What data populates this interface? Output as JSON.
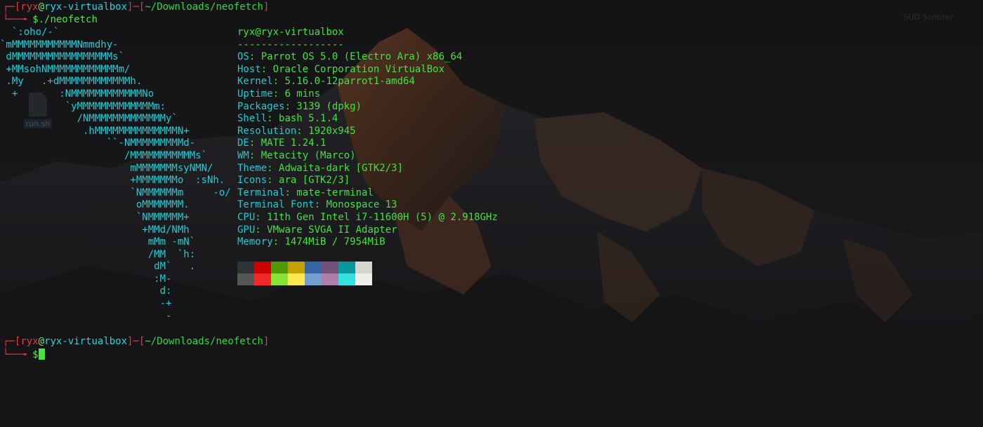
{
  "desktop": {
    "icons": [
      {
        "label": "run.sh"
      },
      {
        "label": "SUD Scripter"
      }
    ]
  },
  "prompt1": {
    "user": "ryx",
    "at": "@",
    "host": "ryx-virtualbox",
    "dir": "~/Downloads/neofetch",
    "symbol": "$",
    "command": "./neofetch"
  },
  "ascii_art": [
    "  `:oho/-`",
    "`mMMMMMMMMMMMNmmdhy-",
    " dMMMMMMMMMMMMMMMMMs`",
    " +MMsohNMMMMMMMMMMMMm/",
    " .My   .+dMMMMMMMMMMMMh.",
    "  +       :NMMMMMMMMMMMMNo",
    "           `yMMMMMMMMMMMMMm:",
    "             /NMMMMMMMMMMMMMy`",
    "              .hMMMMMMMMMMMMMMN+",
    "                  ``-NMMMMMMMMMd-",
    "                     /MMMMMMMMMMMs`",
    "                      mMMMMMMMsyNMN/",
    "                      +MMMMMMMo  :sNh.",
    "                      `NMMMMMMm     -o/",
    "                       oMMMMMMM.",
    "                       `NMMMMMM+",
    "                        +MMd/NMh",
    "                         mMm -mN`",
    "                         /MM  `h:",
    "                          dM`   .",
    "                          :M-",
    "                           d:",
    "                           -+",
    "                            -"
  ],
  "info": {
    "title_user": "ryx",
    "title_at": "@",
    "title_host": "ryx-virtualbox",
    "underline": "------------------",
    "fields": [
      {
        "key": "OS",
        "value": "Parrot OS 5.0 (Electro Ara) x86_64"
      },
      {
        "key": "Host",
        "value": "Oracle Corporation VirtualBox"
      },
      {
        "key": "Kernel",
        "value": "5.16.0-12parrot1-amd64"
      },
      {
        "key": "Uptime",
        "value": "6 mins"
      },
      {
        "key": "Packages",
        "value": "3139 (dpkg)"
      },
      {
        "key": "Shell",
        "value": "bash 5.1.4"
      },
      {
        "key": "Resolution",
        "value": "1920x945"
      },
      {
        "key": "DE",
        "value": "MATE 1.24.1"
      },
      {
        "key": "WM",
        "value": "Metacity (Marco)"
      },
      {
        "key": "Theme",
        "value": "Adwaita-dark [GTK2/3]"
      },
      {
        "key": "Icons",
        "value": "ara [GTK2/3]"
      },
      {
        "key": "Terminal",
        "value": "mate-terminal"
      },
      {
        "key": "Terminal Font",
        "value": "Monospace 13"
      },
      {
        "key": "CPU",
        "value": "11th Gen Intel i7-11600H (5) @ 2.918GHz"
      },
      {
        "key": "GPU",
        "value": "VMware SVGA II Adapter"
      },
      {
        "key": "Memory",
        "value": "1474MiB / 7954MiB"
      }
    ]
  },
  "palette": {
    "row1": [
      "#2e3436",
      "#cc0000",
      "#4e9a06",
      "#c4a000",
      "#3465a4",
      "#75507b",
      "#06989a",
      "#d3d7cf"
    ],
    "row2": [
      "#555753",
      "#ef2929",
      "#8ae234",
      "#fce94f",
      "#729fcf",
      "#ad7fa8",
      "#34e2e2",
      "#eeeeec"
    ]
  },
  "prompt2": {
    "user": "ryx",
    "at": "@",
    "host": "ryx-virtualbox",
    "dir": "~/Downloads/neofetch",
    "symbol": "$"
  },
  "colors": {
    "bracket": "#e33b3b",
    "ascii": "#25cbd4",
    "info_key": "#25c7d1",
    "info_value": "#43e243",
    "cursor": "#3ee63e"
  }
}
